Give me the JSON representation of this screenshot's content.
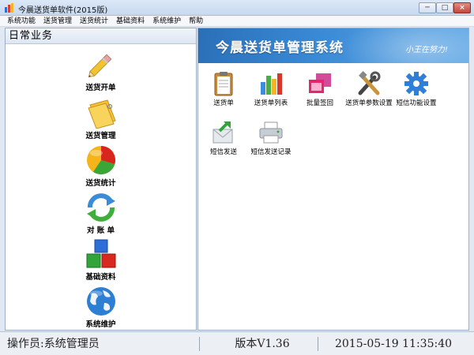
{
  "window": {
    "title": "今晨送货单软件(2015版)",
    "close_glyph": "×",
    "min_glyph": "─",
    "max_glyph": "□"
  },
  "menu": [
    "系统功能",
    "送货管理",
    "送货统计",
    "基础资料",
    "系统维护",
    "帮助"
  ],
  "left_panel": {
    "header": "日常业务",
    "items": [
      {
        "label": "送货开单",
        "icon": "pencil-icon"
      },
      {
        "label": "送货管理",
        "icon": "folder-tag-icon"
      },
      {
        "label": "送货统计",
        "icon": "pie-chart-icon"
      },
      {
        "label": "对 账 单",
        "icon": "refresh-arrows-icon"
      },
      {
        "label": "基础资料",
        "icon": "blocks-icon"
      },
      {
        "label": "系统维护",
        "icon": "globe-icon"
      }
    ]
  },
  "right_panel": {
    "banner_title": "今晨送货单管理系统",
    "banner_slogan": "小王在努力!",
    "functions": [
      {
        "label": "送货单",
        "icon": "clipboard-icon"
      },
      {
        "label": "送货单列表",
        "icon": "bar-chart-icon"
      },
      {
        "label": "批量签回",
        "icon": "stacked-windows-icon"
      },
      {
        "label": "送货单参数设置",
        "icon": "tools-icon"
      },
      {
        "label": "短信功能设置",
        "icon": "gear-icon"
      },
      {
        "label": "短信发送",
        "icon": "envelope-send-icon"
      },
      {
        "label": "短信发送记录",
        "icon": "printer-icon"
      }
    ]
  },
  "status": {
    "operator": "操作员:系统管理员",
    "version": "版本V1.36",
    "datetime": "2015-05-19 11:35:40"
  },
  "colors": {
    "banner": "#2a6fb8",
    "accent": "#3a8ad6"
  }
}
